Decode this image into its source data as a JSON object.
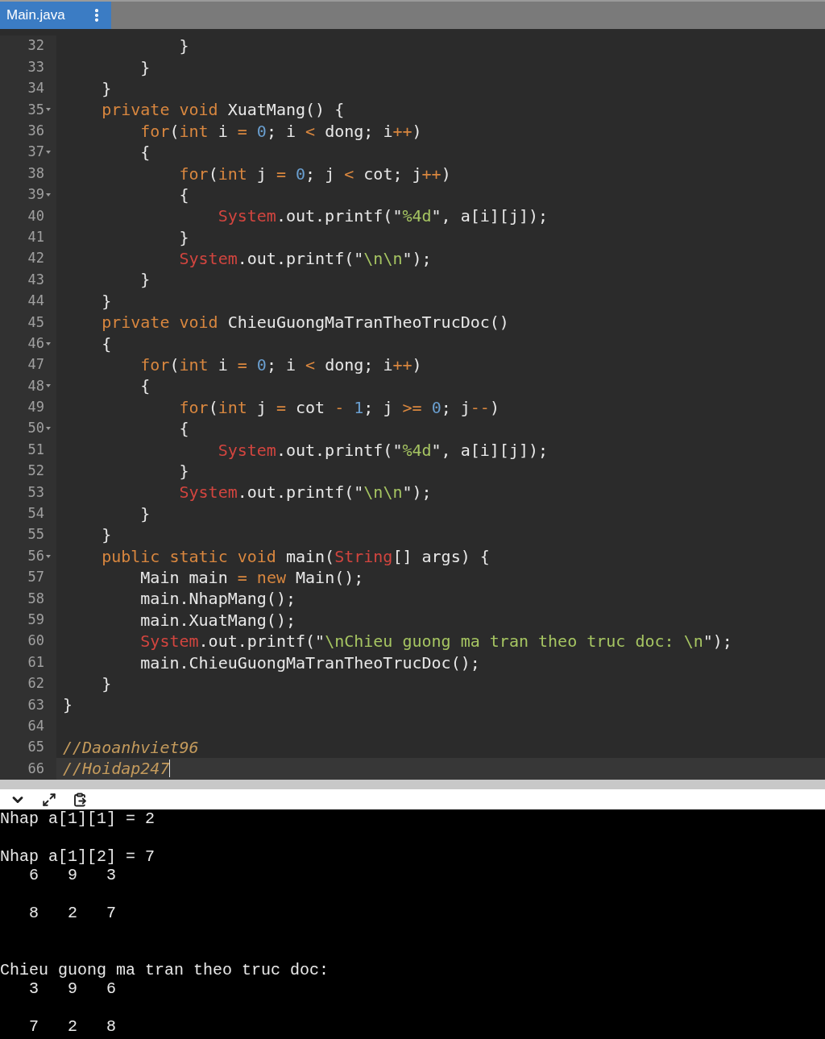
{
  "tab": {
    "title": "Main.java",
    "selected": true
  },
  "editor": {
    "lines": [
      {
        "number": "32",
        "fold": false,
        "current": false,
        "tokens": [
          {
            "kind": "plain",
            "text": "            }"
          }
        ]
      },
      {
        "number": "33",
        "fold": false,
        "current": false,
        "tokens": [
          {
            "kind": "plain",
            "text": "        }"
          }
        ]
      },
      {
        "number": "34",
        "fold": false,
        "current": false,
        "tokens": [
          {
            "kind": "plain",
            "text": "    }"
          }
        ]
      },
      {
        "number": "35",
        "fold": true,
        "current": false,
        "tokens": [
          {
            "kind": "keyword",
            "text": "    private void"
          },
          {
            "kind": "plain",
            "text": " XuatMang() {"
          }
        ]
      },
      {
        "number": "36",
        "fold": false,
        "current": false,
        "tokens": [
          {
            "kind": "keyword",
            "text": "        for"
          },
          {
            "kind": "plain",
            "text": "("
          },
          {
            "kind": "keyword",
            "text": "int"
          },
          {
            "kind": "plain",
            "text": " i "
          },
          {
            "kind": "operator",
            "text": "="
          },
          {
            "kind": "number",
            "text": " 0"
          },
          {
            "kind": "plain",
            "text": "; i "
          },
          {
            "kind": "operator",
            "text": "<"
          },
          {
            "kind": "plain",
            "text": " dong; i"
          },
          {
            "kind": "operator",
            "text": "++"
          },
          {
            "kind": "plain",
            "text": ")"
          }
        ]
      },
      {
        "number": "37",
        "fold": true,
        "current": false,
        "tokens": [
          {
            "kind": "plain",
            "text": "        {"
          }
        ]
      },
      {
        "number": "38",
        "fold": false,
        "current": false,
        "tokens": [
          {
            "kind": "keyword",
            "text": "            for"
          },
          {
            "kind": "plain",
            "text": "("
          },
          {
            "kind": "keyword",
            "text": "int"
          },
          {
            "kind": "plain",
            "text": " j "
          },
          {
            "kind": "operator",
            "text": "="
          },
          {
            "kind": "number",
            "text": " 0"
          },
          {
            "kind": "plain",
            "text": "; j "
          },
          {
            "kind": "operator",
            "text": "<"
          },
          {
            "kind": "plain",
            "text": " cot; j"
          },
          {
            "kind": "operator",
            "text": "++"
          },
          {
            "kind": "plain",
            "text": ")"
          }
        ]
      },
      {
        "number": "39",
        "fold": true,
        "current": false,
        "tokens": [
          {
            "kind": "plain",
            "text": "            {"
          }
        ]
      },
      {
        "number": "40",
        "fold": false,
        "current": false,
        "tokens": [
          {
            "kind": "class",
            "text": "                System"
          },
          {
            "kind": "plain",
            "text": ".out.printf(\""
          },
          {
            "kind": "string",
            "text": "%4d"
          },
          {
            "kind": "plain",
            "text": "\", a[i][j]);"
          }
        ]
      },
      {
        "number": "41",
        "fold": false,
        "current": false,
        "tokens": [
          {
            "kind": "plain",
            "text": "            }"
          }
        ]
      },
      {
        "number": "42",
        "fold": false,
        "current": false,
        "tokens": [
          {
            "kind": "class",
            "text": "            System"
          },
          {
            "kind": "plain",
            "text": ".out.printf(\""
          },
          {
            "kind": "string",
            "text": "\\n\\n"
          },
          {
            "kind": "plain",
            "text": "\");"
          }
        ]
      },
      {
        "number": "43",
        "fold": false,
        "current": false,
        "tokens": [
          {
            "kind": "plain",
            "text": "        }"
          }
        ]
      },
      {
        "number": "44",
        "fold": false,
        "current": false,
        "tokens": [
          {
            "kind": "plain",
            "text": "    }"
          }
        ]
      },
      {
        "number": "45",
        "fold": false,
        "current": false,
        "tokens": [
          {
            "kind": "keyword",
            "text": "    private void"
          },
          {
            "kind": "plain",
            "text": " ChieuGuongMaTranTheoTrucDoc()"
          }
        ]
      },
      {
        "number": "46",
        "fold": true,
        "current": false,
        "tokens": [
          {
            "kind": "plain",
            "text": "    {"
          }
        ]
      },
      {
        "number": "47",
        "fold": false,
        "current": false,
        "tokens": [
          {
            "kind": "keyword",
            "text": "        for"
          },
          {
            "kind": "plain",
            "text": "("
          },
          {
            "kind": "keyword",
            "text": "int"
          },
          {
            "kind": "plain",
            "text": " i "
          },
          {
            "kind": "operator",
            "text": "="
          },
          {
            "kind": "number",
            "text": " 0"
          },
          {
            "kind": "plain",
            "text": "; i "
          },
          {
            "kind": "operator",
            "text": "<"
          },
          {
            "kind": "plain",
            "text": " dong; i"
          },
          {
            "kind": "operator",
            "text": "++"
          },
          {
            "kind": "plain",
            "text": ")"
          }
        ]
      },
      {
        "number": "48",
        "fold": true,
        "current": false,
        "tokens": [
          {
            "kind": "plain",
            "text": "        {"
          }
        ]
      },
      {
        "number": "49",
        "fold": false,
        "current": false,
        "tokens": [
          {
            "kind": "keyword",
            "text": "            for"
          },
          {
            "kind": "plain",
            "text": "("
          },
          {
            "kind": "keyword",
            "text": "int"
          },
          {
            "kind": "plain",
            "text": " j "
          },
          {
            "kind": "operator",
            "text": "="
          },
          {
            "kind": "plain",
            "text": " cot "
          },
          {
            "kind": "operator",
            "text": "-"
          },
          {
            "kind": "number",
            "text": " 1"
          },
          {
            "kind": "plain",
            "text": "; j "
          },
          {
            "kind": "operator",
            "text": ">="
          },
          {
            "kind": "number",
            "text": " 0"
          },
          {
            "kind": "plain",
            "text": "; j"
          },
          {
            "kind": "operator",
            "text": "--"
          },
          {
            "kind": "plain",
            "text": ")"
          }
        ]
      },
      {
        "number": "50",
        "fold": true,
        "current": false,
        "tokens": [
          {
            "kind": "plain",
            "text": "            {"
          }
        ]
      },
      {
        "number": "51",
        "fold": false,
        "current": false,
        "tokens": [
          {
            "kind": "class",
            "text": "                System"
          },
          {
            "kind": "plain",
            "text": ".out.printf(\""
          },
          {
            "kind": "string",
            "text": "%4d"
          },
          {
            "kind": "plain",
            "text": "\", a[i][j]);"
          }
        ]
      },
      {
        "number": "52",
        "fold": false,
        "current": false,
        "tokens": [
          {
            "kind": "plain",
            "text": "            }"
          }
        ]
      },
      {
        "number": "53",
        "fold": false,
        "current": false,
        "tokens": [
          {
            "kind": "class",
            "text": "            System"
          },
          {
            "kind": "plain",
            "text": ".out.printf(\""
          },
          {
            "kind": "string",
            "text": "\\n\\n"
          },
          {
            "kind": "plain",
            "text": "\");"
          }
        ]
      },
      {
        "number": "54",
        "fold": false,
        "current": false,
        "tokens": [
          {
            "kind": "plain",
            "text": "        }"
          }
        ]
      },
      {
        "number": "55",
        "fold": false,
        "current": false,
        "tokens": [
          {
            "kind": "plain",
            "text": "    }"
          }
        ]
      },
      {
        "number": "56",
        "fold": true,
        "current": false,
        "tokens": [
          {
            "kind": "keyword",
            "text": "    public static void"
          },
          {
            "kind": "plain",
            "text": " main("
          },
          {
            "kind": "class",
            "text": "String"
          },
          {
            "kind": "plain",
            "text": "[] args) {"
          }
        ]
      },
      {
        "number": "57",
        "fold": false,
        "current": false,
        "tokens": [
          {
            "kind": "plain",
            "text": "        Main main "
          },
          {
            "kind": "operator",
            "text": "="
          },
          {
            "kind": "keyword",
            "text": " new"
          },
          {
            "kind": "plain",
            "text": " Main();"
          }
        ]
      },
      {
        "number": "58",
        "fold": false,
        "current": false,
        "tokens": [
          {
            "kind": "plain",
            "text": "        main.NhapMang();"
          }
        ]
      },
      {
        "number": "59",
        "fold": false,
        "current": false,
        "tokens": [
          {
            "kind": "plain",
            "text": "        main.XuatMang();"
          }
        ]
      },
      {
        "number": "60",
        "fold": false,
        "current": false,
        "tokens": [
          {
            "kind": "class",
            "text": "        System"
          },
          {
            "kind": "plain",
            "text": ".out.printf(\""
          },
          {
            "kind": "string",
            "text": "\\nChieu guong ma tran theo truc doc: \\n"
          },
          {
            "kind": "plain",
            "text": "\");"
          }
        ]
      },
      {
        "number": "61",
        "fold": false,
        "current": false,
        "tokens": [
          {
            "kind": "plain",
            "text": "        main.ChieuGuongMaTranTheoTrucDoc();"
          }
        ]
      },
      {
        "number": "62",
        "fold": false,
        "current": false,
        "tokens": [
          {
            "kind": "plain",
            "text": "    }"
          }
        ]
      },
      {
        "number": "63",
        "fold": false,
        "current": false,
        "tokens": [
          {
            "kind": "plain",
            "text": "}"
          }
        ]
      },
      {
        "number": "64",
        "fold": false,
        "current": false
      },
      {
        "number": "65",
        "fold": false,
        "current": false,
        "tokens": [
          {
            "kind": "comment",
            "text": "//Daoanhviet96"
          }
        ]
      },
      {
        "number": "66",
        "fold": false,
        "current": true,
        "tokens": [
          {
            "kind": "comment",
            "text": "//Hoidap247"
          }
        ]
      }
    ]
  },
  "console": {
    "lines": [
      {
        "kind": "text",
        "text": "Nhap a[1][1] = 2"
      },
      {
        "kind": "blank"
      },
      {
        "kind": "text",
        "text": "Nhap a[1][2] = 7"
      },
      {
        "kind": "text",
        "text": "   6   9   3"
      },
      {
        "kind": "blank"
      },
      {
        "kind": "text",
        "text": "   8   2   7"
      },
      {
        "kind": "blank"
      },
      {
        "kind": "blank"
      },
      {
        "kind": "text",
        "text": "Chieu guong ma tran theo truc doc:"
      },
      {
        "kind": "text",
        "text": "   3   9   6"
      },
      {
        "kind": "blank"
      },
      {
        "kind": "text",
        "text": "   7   2   8"
      }
    ]
  }
}
